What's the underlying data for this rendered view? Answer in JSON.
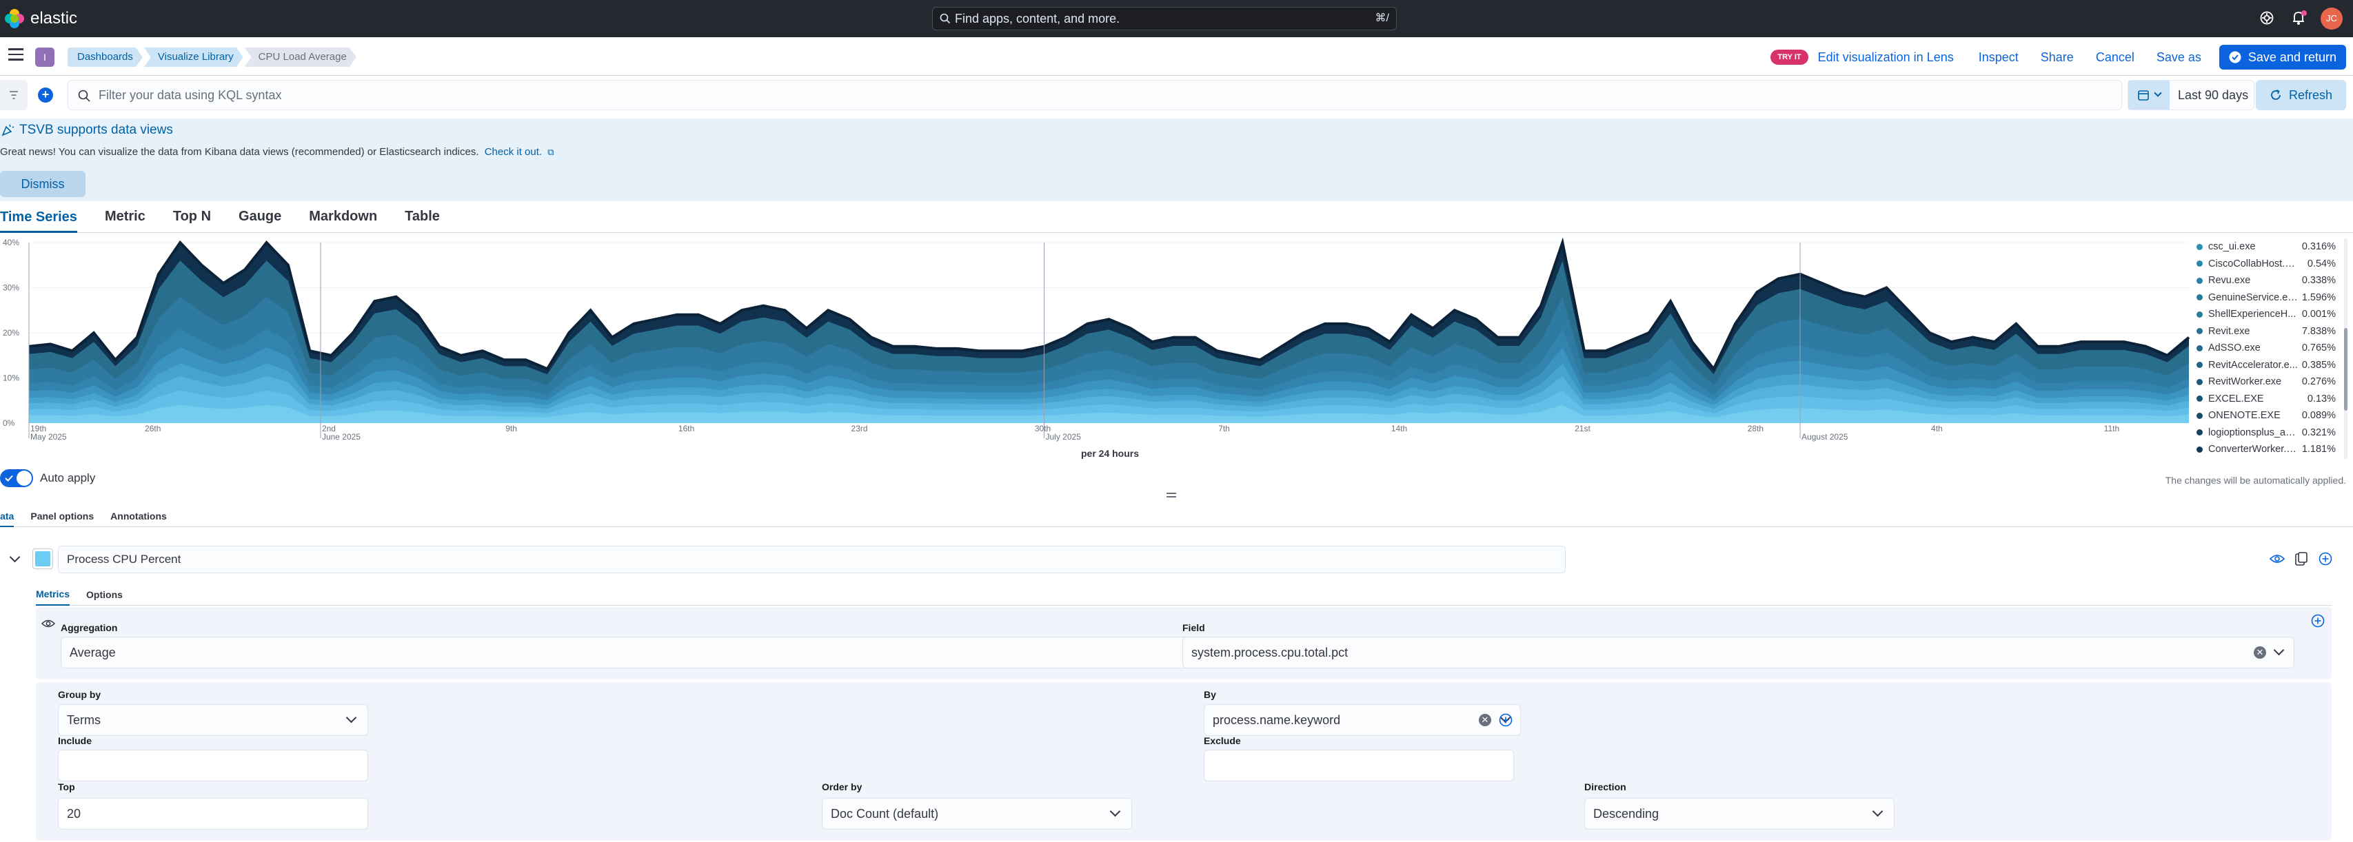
{
  "topbar": {
    "logo_text": "elastic",
    "search_placeholder": "Find apps, content, and more.",
    "search_shortcut": "⌘/",
    "avatar_initials": "JC"
  },
  "header": {
    "space_badge": "I",
    "breadcrumbs": [
      "Dashboards",
      "Visualize Library",
      "CPU Load Average"
    ],
    "try_it_badge": "TRY IT",
    "edit_lens_label": "Edit visualization in Lens",
    "inspect_label": "Inspect",
    "share_label": "Share",
    "cancel_label": "Cancel",
    "save_as_label": "Save as",
    "save_return_label": "Save and return"
  },
  "query": {
    "placeholder": "Filter your data using KQL syntax",
    "date_range": "Last 90 days",
    "refresh_label": "Refresh"
  },
  "callout": {
    "title": "TSVB supports data views",
    "text": "Great news! You can visualize the data from Kibana data views (recommended) or Elasticsearch indices.",
    "link": "Check it out.",
    "dismiss_label": "Dismiss"
  },
  "viz_tabs": [
    "Time Series",
    "Metric",
    "Top N",
    "Gauge",
    "Markdown",
    "Table"
  ],
  "chart_data": {
    "type": "area",
    "ylim": [
      0,
      40
    ],
    "y_ticks": [
      "40%",
      "30%",
      "20%",
      "10%",
      "0%"
    ],
    "x_ticks": [
      {
        "label": "19th",
        "sub": "May 2025"
      },
      {
        "label": "26th",
        "sub": ""
      },
      {
        "label": "2nd",
        "sub": "June 2025"
      },
      {
        "label": "9th",
        "sub": ""
      },
      {
        "label": "16th",
        "sub": ""
      },
      {
        "label": "23rd",
        "sub": ""
      },
      {
        "label": "30th",
        "sub": ""
      },
      {
        "label": "",
        "sub": "July 2025"
      },
      {
        "label": "7th",
        "sub": ""
      },
      {
        "label": "14th",
        "sub": ""
      },
      {
        "label": "21st",
        "sub": ""
      },
      {
        "label": "28th",
        "sub": ""
      },
      {
        "label": "",
        "sub": "August 2025"
      },
      {
        "label": "4th",
        "sub": ""
      },
      {
        "label": "11th",
        "sub": ""
      }
    ],
    "x_axis_label": "per 24 hours",
    "total_series": [
      17,
      17.5,
      16,
      20,
      14,
      19,
      33,
      40,
      35,
      31,
      34,
      40,
      35,
      16,
      15,
      20,
      27,
      28,
      24,
      17,
      15,
      16,
      14,
      14,
      12,
      20,
      25,
      19,
      22,
      23,
      24,
      24,
      22,
      25,
      26,
      25,
      21,
      25,
      23,
      19,
      17,
      17,
      16.5,
      16.5,
      16,
      16,
      16,
      17,
      19,
      22,
      23,
      21,
      18,
      19,
      19,
      16,
      15,
      14,
      17,
      20,
      22,
      22,
      21,
      18,
      24,
      21,
      25,
      23,
      19,
      19,
      26,
      40,
      16,
      16,
      18,
      20,
      27,
      18,
      12,
      22,
      29,
      32,
      33,
      31,
      29,
      28,
      30,
      25,
      20,
      18,
      19,
      18,
      22,
      17,
      17,
      18,
      18,
      18,
      17,
      15,
      19
    ],
    "legend": [
      {
        "name": "csc_ui.exe",
        "value": "0.316%",
        "color": "#2e8fb0"
      },
      {
        "name": "CiscoCollabHost.exe",
        "value": "0.54%",
        "color": "#2b86aa"
      },
      {
        "name": "Revu.exe",
        "value": "0.338%",
        "color": "#2a80a3"
      },
      {
        "name": "GenuineService.exe",
        "value": "1.596%",
        "color": "#28799c"
      },
      {
        "name": "ShellExperienceH...",
        "value": "0.001%",
        "color": "#2b7b98"
      },
      {
        "name": "Revit.exe",
        "value": "7.838%",
        "color": "#267194"
      },
      {
        "name": "AdSSO.exe",
        "value": "0.765%",
        "color": "#23698c"
      },
      {
        "name": "RevitAccelerator.e...",
        "value": "0.385%",
        "color": "#216283"
      },
      {
        "name": "RevitWorker.exe",
        "value": "0.276%",
        "color": "#1e5a7b"
      },
      {
        "name": "EXCEL.EXE",
        "value": "0.13%",
        "color": "#1b5272"
      },
      {
        "name": "ONENOTE.EXE",
        "value": "0.089%",
        "color": "#184a69"
      },
      {
        "name": "logioptionsplus_ag...",
        "value": "0.321%",
        "color": "#164361"
      },
      {
        "name": "ConverterWorker.e...",
        "value": "1.181%",
        "color": "#133b58"
      }
    ]
  },
  "editor": {
    "auto_apply_label": "Auto apply",
    "auto_apply_note": "The changes will be automatically applied.",
    "tabs": [
      "Data",
      "Panel options",
      "Annotations"
    ],
    "series_label": "Process CPU Percent",
    "series_color": "#6dccf1",
    "subtabs": [
      "Metrics",
      "Options"
    ],
    "aggregation_label": "Aggregation",
    "aggregation_value": "Average",
    "field_label": "Field",
    "field_value": "system.process.cpu.total.pct",
    "group_by_label": "Group by",
    "group_by_value": "Terms",
    "by_label": "By",
    "by_value": "process.name.keyword",
    "include_label": "Include",
    "exclude_label": "Exclude",
    "top_label": "Top",
    "top_value": "20",
    "order_by_label": "Order by",
    "order_by_value": "Doc Count (default)",
    "direction_label": "Direction",
    "direction_value": "Descending"
  }
}
